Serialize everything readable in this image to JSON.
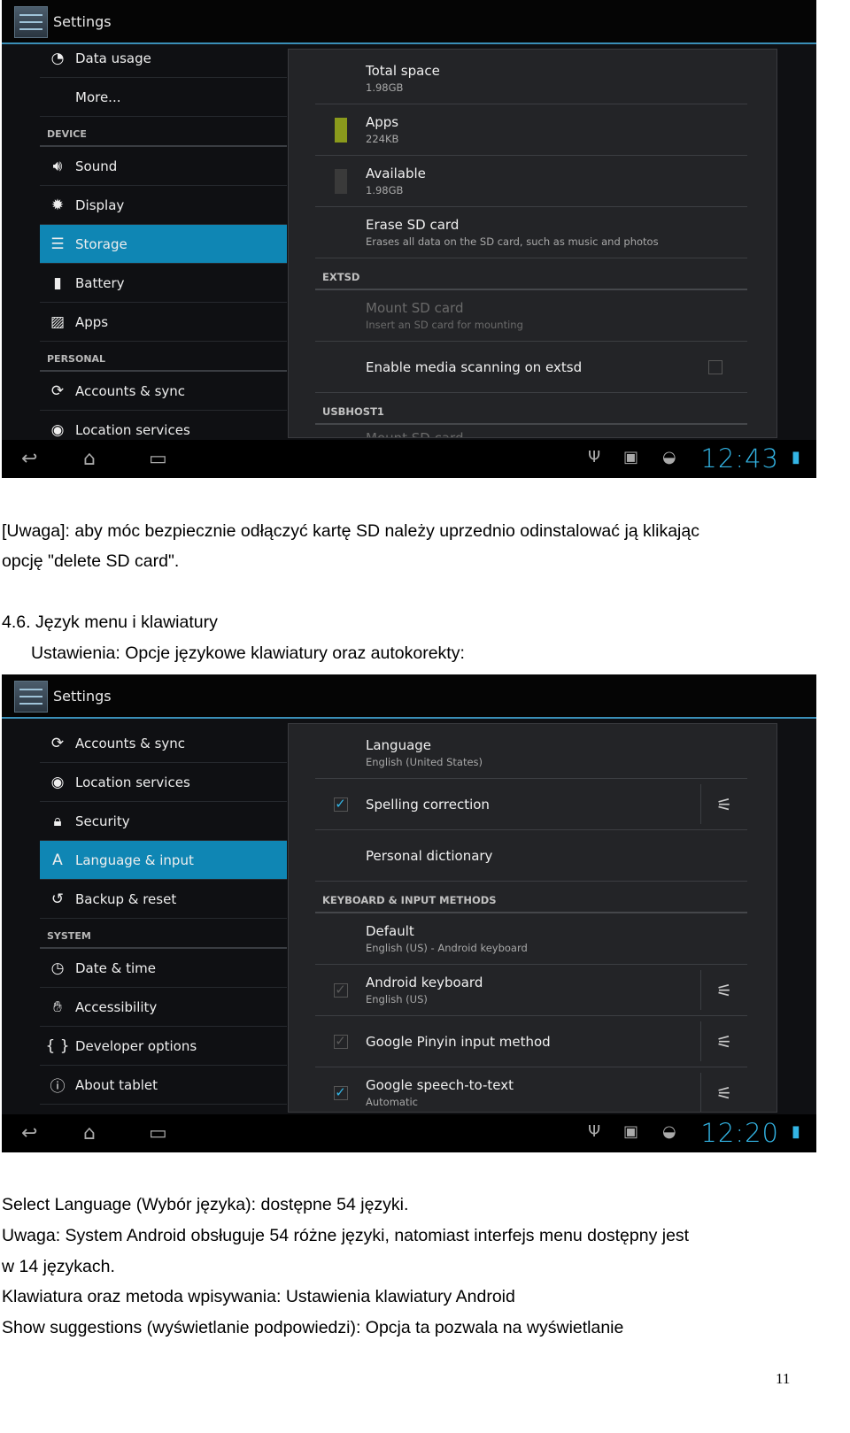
{
  "screens": [
    {
      "title": "Settings",
      "clock": "12:43",
      "left": [
        {
          "type": "item",
          "icon": "data-usage-icon",
          "glyph": "◔",
          "label": "Data usage"
        },
        {
          "type": "item",
          "icon": "",
          "glyph": "",
          "label": "More..."
        },
        {
          "type": "header",
          "label": "DEVICE"
        },
        {
          "type": "item",
          "icon": "sound-icon",
          "glyph": "🔊︎",
          "label": "Sound"
        },
        {
          "type": "item",
          "icon": "display-icon",
          "glyph": "✹",
          "label": "Display"
        },
        {
          "type": "item",
          "icon": "storage-icon",
          "glyph": "☰",
          "label": "Storage",
          "selected": true
        },
        {
          "type": "item",
          "icon": "battery-icon",
          "glyph": "▮",
          "label": "Battery"
        },
        {
          "type": "item",
          "icon": "apps-icon",
          "glyph": "▨",
          "label": "Apps"
        },
        {
          "type": "header",
          "label": "PERSONAL"
        },
        {
          "type": "item",
          "icon": "sync-icon",
          "glyph": "⟳",
          "label": "Accounts & sync"
        },
        {
          "type": "item",
          "icon": "location-icon",
          "glyph": "◉",
          "label": "Location services"
        }
      ],
      "right": [
        {
          "type": "item",
          "title": "Total space",
          "summary": "1.98GB"
        },
        {
          "type": "item",
          "title": "Apps",
          "summary": "224KB",
          "chip": "#8a9a1c"
        },
        {
          "type": "item",
          "title": "Available",
          "summary": "1.98GB",
          "chip": "#3a3a3a"
        },
        {
          "type": "item",
          "title": "Erase SD card",
          "summary": "Erases all data on the SD card, such as music and photos"
        },
        {
          "type": "header",
          "label": "EXTSD"
        },
        {
          "type": "item",
          "title": "Mount SD card",
          "summary": "Insert an SD card for mounting",
          "disabled": true
        },
        {
          "type": "item",
          "title": "Enable media scanning on extsd",
          "checkbox_right": "unchecked"
        },
        {
          "type": "header",
          "label": "USBHOST1"
        },
        {
          "type": "item",
          "title": "Mount SD card",
          "disabled": true
        }
      ]
    },
    {
      "title": "Settings",
      "clock": "12:20",
      "left": [
        {
          "type": "item",
          "icon": "sync-icon",
          "glyph": "⟳",
          "label": "Accounts & sync"
        },
        {
          "type": "item",
          "icon": "location-icon",
          "glyph": "◉",
          "label": "Location services"
        },
        {
          "type": "item",
          "icon": "lock-icon",
          "glyph": "🔒︎",
          "label": "Security"
        },
        {
          "type": "item",
          "icon": "language-icon",
          "glyph": "A",
          "label": "Language & input",
          "selected": true
        },
        {
          "type": "item",
          "icon": "backup-icon",
          "glyph": "↺",
          "label": "Backup & reset"
        },
        {
          "type": "header",
          "label": "SYSTEM"
        },
        {
          "type": "item",
          "icon": "clock-icon",
          "glyph": "◷",
          "label": "Date & time"
        },
        {
          "type": "item",
          "icon": "accessibility-icon",
          "glyph": "✋︎",
          "label": "Accessibility"
        },
        {
          "type": "item",
          "icon": "developer-icon",
          "glyph": "{ }",
          "label": "Developer options"
        },
        {
          "type": "item",
          "icon": "info-icon",
          "glyph": "ⓘ",
          "label": "About tablet"
        }
      ],
      "right": [
        {
          "type": "item",
          "title": "Language",
          "summary": "English (United States)"
        },
        {
          "type": "item",
          "title": "Spelling correction",
          "checkbox": "checked",
          "settings": true
        },
        {
          "type": "item",
          "title": "Personal dictionary"
        },
        {
          "type": "header",
          "label": "KEYBOARD & INPUT METHODS"
        },
        {
          "type": "item",
          "title": "Default",
          "summary": "English (US) - Android keyboard"
        },
        {
          "type": "item",
          "title": "Android keyboard",
          "summary": "English (US)",
          "checkbox": "checked-disabled",
          "settings": true
        },
        {
          "type": "item",
          "title": "Google Pinyin input method",
          "checkbox": "checked-disabled",
          "settings": true
        },
        {
          "type": "item",
          "title": "Google speech-to-text",
          "summary": "Automatic",
          "checkbox": "checked",
          "settings": true
        }
      ]
    }
  ],
  "text": {
    "note1": "[Uwaga]: aby móc bezpiecznie odłączyć kartę SD należy uprzednio odinstalować ją klikając",
    "note2": "opcję \"delete SD card\".",
    "section": "4.6. Język menu i klawiatury",
    "subsection": "Ustawienia: Opcje językowe klawiatury oraz autokorekty:",
    "p1": "Select Language (Wybór języka): dostępne 54 języki.",
    "p2": "Uwaga: System Android obsługuje 54 różne języki, natomiast interfejs menu dostępny jest",
    "p3": "w 14 językach.",
    "p4": "Klawiatura oraz metoda wpisywania: Ustawienia klawiatury Android",
    "p5": "Show suggestions (wyświetlanie podpowiedzi): Opcja ta pozwala na wyświetlanie",
    "page_number": "11"
  },
  "colors": {
    "accent": "#33b5e5",
    "selected": "#0f86b4"
  }
}
